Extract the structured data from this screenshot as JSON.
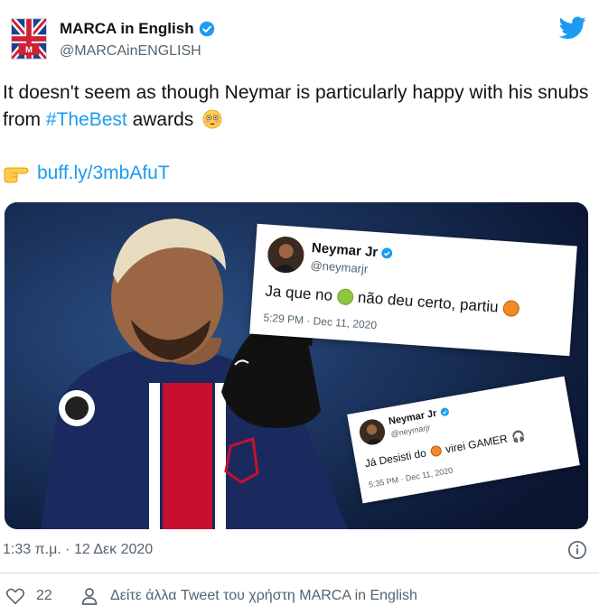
{
  "account": {
    "display_name": "MARCA in English",
    "handle": "@MARCAinENGLISH",
    "avatar_icon": "union-jack-marca-avatar",
    "verified_icon": "verified-badge-icon",
    "platform_icon": "twitter-bird-icon"
  },
  "tweet": {
    "text_before_hashtag": "It doesn't seem as though Neymar is particularly happy with his snubs from ",
    "hashtag": "#TheBest",
    "text_after_hashtag": " awards",
    "flushed_emoji": "flushed-face-emoji",
    "pointing_emoji": "pointing-right-emoji",
    "link": "buff.ly/3mbAfuT"
  },
  "media": {
    "description_icon": "neymar-photo",
    "embedded_tweets": [
      {
        "name": "Neymar Jr",
        "handle": "@neymarjr",
        "text_part1": "Ja que no",
        "text_part2": "não deu certo, partiu",
        "time": "5:29 PM · Dec 11, 2020"
      },
      {
        "name": "Neymar Jr",
        "handle": "@neymarjr",
        "text_part1": "Já Desisti do",
        "text_part2": "virei GAMER",
        "time": "5:35 PM · Dec 11, 2020"
      }
    ]
  },
  "footer": {
    "timestamp": "1:33 π.μ. · 12 Δεκ 2020",
    "likes": "22",
    "more_tweets": "Δείτε άλλα Tweet του χρήστη MARCA in English"
  },
  "colors": {
    "accent": "#1d9bf0",
    "text": "#0f1419",
    "secondary": "#536471"
  }
}
